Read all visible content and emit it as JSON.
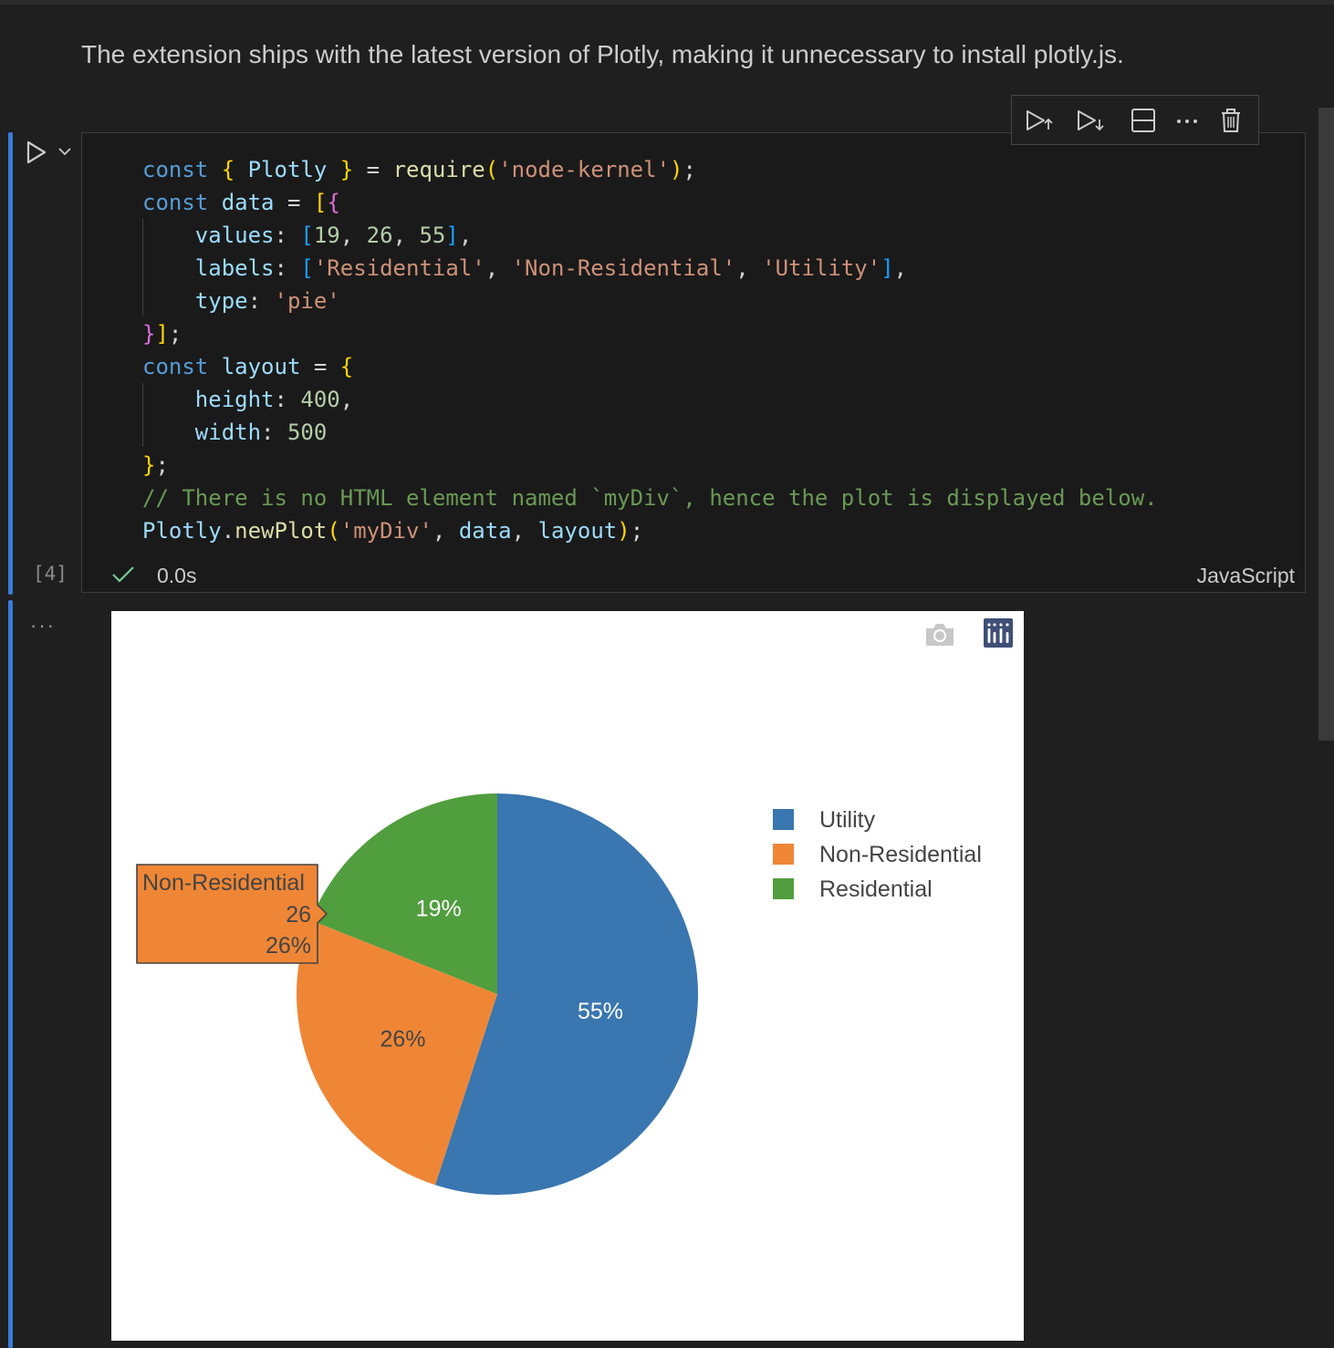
{
  "markdown": {
    "text": "The extension ships with the latest version of Plotly, making it unnecessary to install plotly.js."
  },
  "cell": {
    "execution_count": "[4]",
    "status_time": "0.0s",
    "language": "JavaScript",
    "output_more": "···",
    "code_lines": [
      [
        [
          "k",
          "const "
        ],
        [
          "b1",
          "{ "
        ],
        [
          "v",
          "Plotly"
        ],
        [
          "b1",
          " }"
        ],
        [
          "p",
          " = "
        ],
        [
          "f",
          "require"
        ],
        [
          "b1",
          "("
        ],
        [
          "s",
          "'node-kernel'"
        ],
        [
          "b1",
          ")"
        ],
        [
          "p",
          ";"
        ]
      ],
      [
        [
          "k",
          "const "
        ],
        [
          "v",
          "data"
        ],
        [
          "p",
          " = "
        ],
        [
          "b1",
          "["
        ],
        [
          "b2",
          "{"
        ]
      ],
      [
        [
          "p",
          "    "
        ],
        [
          "v",
          "values"
        ],
        [
          "p",
          ": "
        ],
        [
          "b3",
          "["
        ],
        [
          "n",
          "19"
        ],
        [
          "p",
          ", "
        ],
        [
          "n",
          "26"
        ],
        [
          "p",
          ", "
        ],
        [
          "n",
          "55"
        ],
        [
          "b3",
          "]"
        ],
        [
          "p",
          ","
        ]
      ],
      [
        [
          "p",
          "    "
        ],
        [
          "v",
          "labels"
        ],
        [
          "p",
          ": "
        ],
        [
          "b3",
          "["
        ],
        [
          "s",
          "'Residential'"
        ],
        [
          "p",
          ", "
        ],
        [
          "s",
          "'Non-Residential'"
        ],
        [
          "p",
          ", "
        ],
        [
          "s",
          "'Utility'"
        ],
        [
          "b3",
          "]"
        ],
        [
          "p",
          ","
        ]
      ],
      [
        [
          "p",
          "    "
        ],
        [
          "v",
          "type"
        ],
        [
          "p",
          ": "
        ],
        [
          "s",
          "'pie'"
        ]
      ],
      [
        [
          "b2",
          "}"
        ],
        [
          "b1",
          "]"
        ],
        [
          "p",
          ";"
        ]
      ],
      [
        [
          "k",
          "const "
        ],
        [
          "v",
          "layout"
        ],
        [
          "p",
          " = "
        ],
        [
          "b1",
          "{"
        ]
      ],
      [
        [
          "p",
          "    "
        ],
        [
          "v",
          "height"
        ],
        [
          "p",
          ": "
        ],
        [
          "n",
          "400"
        ],
        [
          "p",
          ","
        ]
      ],
      [
        [
          "p",
          "    "
        ],
        [
          "v",
          "width"
        ],
        [
          "p",
          ": "
        ],
        [
          "n",
          "500"
        ]
      ],
      [
        [
          "b1",
          "}"
        ],
        [
          "p",
          ";"
        ]
      ],
      [
        [
          "c",
          "// There is no HTML element named `myDiv`, hence the plot is displayed below."
        ]
      ],
      [
        [
          "v",
          "Plotly"
        ],
        [
          "p",
          "."
        ],
        [
          "f",
          "newPlot"
        ],
        [
          "b1",
          "("
        ],
        [
          "s",
          "'myDiv'"
        ],
        [
          "p",
          ", "
        ],
        [
          "v",
          "data"
        ],
        [
          "p",
          ", "
        ],
        [
          "v",
          "layout"
        ],
        [
          "b1",
          ")"
        ],
        [
          "p",
          ";"
        ]
      ]
    ]
  },
  "toolbar": {
    "icons": [
      "execute-above-icon",
      "execute-below-icon",
      "split-cell-icon",
      "more-actions-icon",
      "delete-cell-icon"
    ]
  },
  "colors": {
    "accent": "#3a7ad8",
    "utility": "#3a76af",
    "non_residential": "#ef8636",
    "residential": "#519e3e"
  },
  "chart_data": {
    "type": "pie",
    "labels": [
      "Residential",
      "Non-Residential",
      "Utility"
    ],
    "values": [
      19,
      26,
      55
    ],
    "percent_labels": [
      "19%",
      "26%",
      "55%"
    ],
    "legend": [
      "Utility",
      "Non-Residential",
      "Residential"
    ],
    "legend_placement": "top-right",
    "hover": {
      "label": "Non-Residential",
      "value": "26",
      "percent": "26%"
    }
  }
}
